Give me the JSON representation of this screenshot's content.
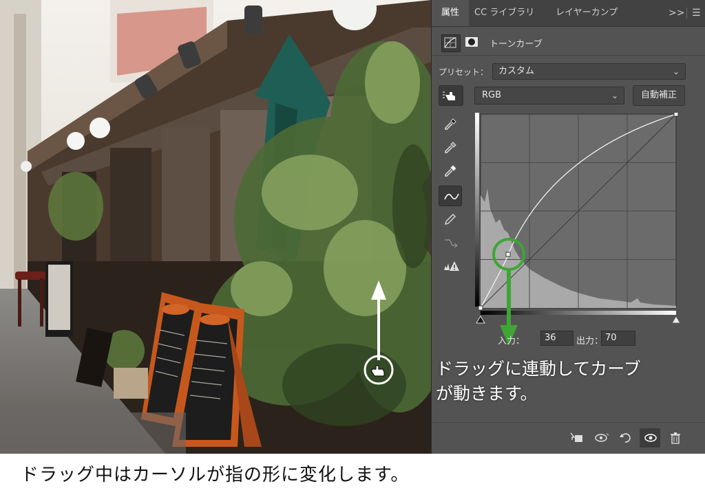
{
  "panel": {
    "tabs": [
      "属性",
      "CC ライブラリ",
      "レイヤーカンプ"
    ],
    "tab_icons": [
      "expand-icon",
      "menu-icon"
    ],
    "adjustment_title": "トーンカーブ",
    "preset_label": "プリセット：",
    "preset_value": "カスタム",
    "channel_value": "RGB",
    "auto_label": "自動補正",
    "input_label": "入力：",
    "input_value": "36",
    "output_label": "出力：",
    "output_value": "70",
    "curve_point": {
      "input": 36,
      "output": 70
    }
  },
  "annotations": {
    "panel_note": "ドラッグに連動してカーブ",
    "panel_note_line2": "が動きます。",
    "caption": "ドラッグ中はカーソルが指の形に変化します。"
  },
  "colors": {
    "accent_green": "#3fa535",
    "panel_bg": "#535353"
  }
}
